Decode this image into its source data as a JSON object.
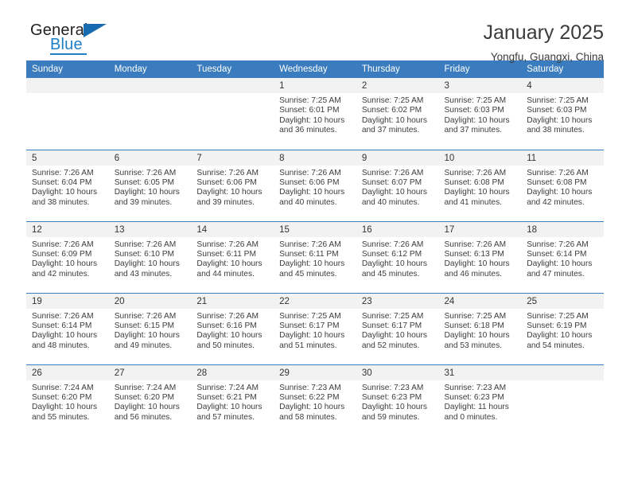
{
  "logo": {
    "word_one": "General",
    "word_two": "Blue",
    "triangle_icon": "triangle-icon",
    "accent_color": "#1f7fc4"
  },
  "header": {
    "title": "January 2025",
    "subtitle": "Yongfu, Guangxi, China"
  },
  "calendar": {
    "header_bg": "#3a7cbe",
    "daynum_bg": "#f2f2f2",
    "weekday_headers": [
      "Sunday",
      "Monday",
      "Tuesday",
      "Wednesday",
      "Thursday",
      "Friday",
      "Saturday"
    ],
    "weeks": [
      [
        {
          "day": "",
          "empty": true,
          "sunrise": "",
          "sunset": "",
          "daylight1": "",
          "daylight2": ""
        },
        {
          "day": "",
          "empty": true,
          "sunrise": "",
          "sunset": "",
          "daylight1": "",
          "daylight2": ""
        },
        {
          "day": "",
          "empty": true,
          "sunrise": "",
          "sunset": "",
          "daylight1": "",
          "daylight2": ""
        },
        {
          "day": "1",
          "sunrise": "Sunrise: 7:25 AM",
          "sunset": "Sunset: 6:01 PM",
          "daylight1": "Daylight: 10 hours",
          "daylight2": "and 36 minutes."
        },
        {
          "day": "2",
          "sunrise": "Sunrise: 7:25 AM",
          "sunset": "Sunset: 6:02 PM",
          "daylight1": "Daylight: 10 hours",
          "daylight2": "and 37 minutes."
        },
        {
          "day": "3",
          "sunrise": "Sunrise: 7:25 AM",
          "sunset": "Sunset: 6:03 PM",
          "daylight1": "Daylight: 10 hours",
          "daylight2": "and 37 minutes."
        },
        {
          "day": "4",
          "sunrise": "Sunrise: 7:25 AM",
          "sunset": "Sunset: 6:03 PM",
          "daylight1": "Daylight: 10 hours",
          "daylight2": "and 38 minutes."
        }
      ],
      [
        {
          "day": "5",
          "sunrise": "Sunrise: 7:26 AM",
          "sunset": "Sunset: 6:04 PM",
          "daylight1": "Daylight: 10 hours",
          "daylight2": "and 38 minutes."
        },
        {
          "day": "6",
          "sunrise": "Sunrise: 7:26 AM",
          "sunset": "Sunset: 6:05 PM",
          "daylight1": "Daylight: 10 hours",
          "daylight2": "and 39 minutes."
        },
        {
          "day": "7",
          "sunrise": "Sunrise: 7:26 AM",
          "sunset": "Sunset: 6:06 PM",
          "daylight1": "Daylight: 10 hours",
          "daylight2": "and 39 minutes."
        },
        {
          "day": "8",
          "sunrise": "Sunrise: 7:26 AM",
          "sunset": "Sunset: 6:06 PM",
          "daylight1": "Daylight: 10 hours",
          "daylight2": "and 40 minutes."
        },
        {
          "day": "9",
          "sunrise": "Sunrise: 7:26 AM",
          "sunset": "Sunset: 6:07 PM",
          "daylight1": "Daylight: 10 hours",
          "daylight2": "and 40 minutes."
        },
        {
          "day": "10",
          "sunrise": "Sunrise: 7:26 AM",
          "sunset": "Sunset: 6:08 PM",
          "daylight1": "Daylight: 10 hours",
          "daylight2": "and 41 minutes."
        },
        {
          "day": "11",
          "sunrise": "Sunrise: 7:26 AM",
          "sunset": "Sunset: 6:08 PM",
          "daylight1": "Daylight: 10 hours",
          "daylight2": "and 42 minutes."
        }
      ],
      [
        {
          "day": "12",
          "sunrise": "Sunrise: 7:26 AM",
          "sunset": "Sunset: 6:09 PM",
          "daylight1": "Daylight: 10 hours",
          "daylight2": "and 42 minutes."
        },
        {
          "day": "13",
          "sunrise": "Sunrise: 7:26 AM",
          "sunset": "Sunset: 6:10 PM",
          "daylight1": "Daylight: 10 hours",
          "daylight2": "and 43 minutes."
        },
        {
          "day": "14",
          "sunrise": "Sunrise: 7:26 AM",
          "sunset": "Sunset: 6:11 PM",
          "daylight1": "Daylight: 10 hours",
          "daylight2": "and 44 minutes."
        },
        {
          "day": "15",
          "sunrise": "Sunrise: 7:26 AM",
          "sunset": "Sunset: 6:11 PM",
          "daylight1": "Daylight: 10 hours",
          "daylight2": "and 45 minutes."
        },
        {
          "day": "16",
          "sunrise": "Sunrise: 7:26 AM",
          "sunset": "Sunset: 6:12 PM",
          "daylight1": "Daylight: 10 hours",
          "daylight2": "and 45 minutes."
        },
        {
          "day": "17",
          "sunrise": "Sunrise: 7:26 AM",
          "sunset": "Sunset: 6:13 PM",
          "daylight1": "Daylight: 10 hours",
          "daylight2": "and 46 minutes."
        },
        {
          "day": "18",
          "sunrise": "Sunrise: 7:26 AM",
          "sunset": "Sunset: 6:14 PM",
          "daylight1": "Daylight: 10 hours",
          "daylight2": "and 47 minutes."
        }
      ],
      [
        {
          "day": "19",
          "sunrise": "Sunrise: 7:26 AM",
          "sunset": "Sunset: 6:14 PM",
          "daylight1": "Daylight: 10 hours",
          "daylight2": "and 48 minutes."
        },
        {
          "day": "20",
          "sunrise": "Sunrise: 7:26 AM",
          "sunset": "Sunset: 6:15 PM",
          "daylight1": "Daylight: 10 hours",
          "daylight2": "and 49 minutes."
        },
        {
          "day": "21",
          "sunrise": "Sunrise: 7:26 AM",
          "sunset": "Sunset: 6:16 PM",
          "daylight1": "Daylight: 10 hours",
          "daylight2": "and 50 minutes."
        },
        {
          "day": "22",
          "sunrise": "Sunrise: 7:25 AM",
          "sunset": "Sunset: 6:17 PM",
          "daylight1": "Daylight: 10 hours",
          "daylight2": "and 51 minutes."
        },
        {
          "day": "23",
          "sunrise": "Sunrise: 7:25 AM",
          "sunset": "Sunset: 6:17 PM",
          "daylight1": "Daylight: 10 hours",
          "daylight2": "and 52 minutes."
        },
        {
          "day": "24",
          "sunrise": "Sunrise: 7:25 AM",
          "sunset": "Sunset: 6:18 PM",
          "daylight1": "Daylight: 10 hours",
          "daylight2": "and 53 minutes."
        },
        {
          "day": "25",
          "sunrise": "Sunrise: 7:25 AM",
          "sunset": "Sunset: 6:19 PM",
          "daylight1": "Daylight: 10 hours",
          "daylight2": "and 54 minutes."
        }
      ],
      [
        {
          "day": "26",
          "sunrise": "Sunrise: 7:24 AM",
          "sunset": "Sunset: 6:20 PM",
          "daylight1": "Daylight: 10 hours",
          "daylight2": "and 55 minutes."
        },
        {
          "day": "27",
          "sunrise": "Sunrise: 7:24 AM",
          "sunset": "Sunset: 6:20 PM",
          "daylight1": "Daylight: 10 hours",
          "daylight2": "and 56 minutes."
        },
        {
          "day": "28",
          "sunrise": "Sunrise: 7:24 AM",
          "sunset": "Sunset: 6:21 PM",
          "daylight1": "Daylight: 10 hours",
          "daylight2": "and 57 minutes."
        },
        {
          "day": "29",
          "sunrise": "Sunrise: 7:23 AM",
          "sunset": "Sunset: 6:22 PM",
          "daylight1": "Daylight: 10 hours",
          "daylight2": "and 58 minutes."
        },
        {
          "day": "30",
          "sunrise": "Sunrise: 7:23 AM",
          "sunset": "Sunset: 6:23 PM",
          "daylight1": "Daylight: 10 hours",
          "daylight2": "and 59 minutes."
        },
        {
          "day": "31",
          "sunrise": "Sunrise: 7:23 AM",
          "sunset": "Sunset: 6:23 PM",
          "daylight1": "Daylight: 11 hours",
          "daylight2": "and 0 minutes."
        },
        {
          "day": "",
          "empty": true,
          "sunrise": "",
          "sunset": "",
          "daylight1": "",
          "daylight2": ""
        }
      ]
    ]
  }
}
